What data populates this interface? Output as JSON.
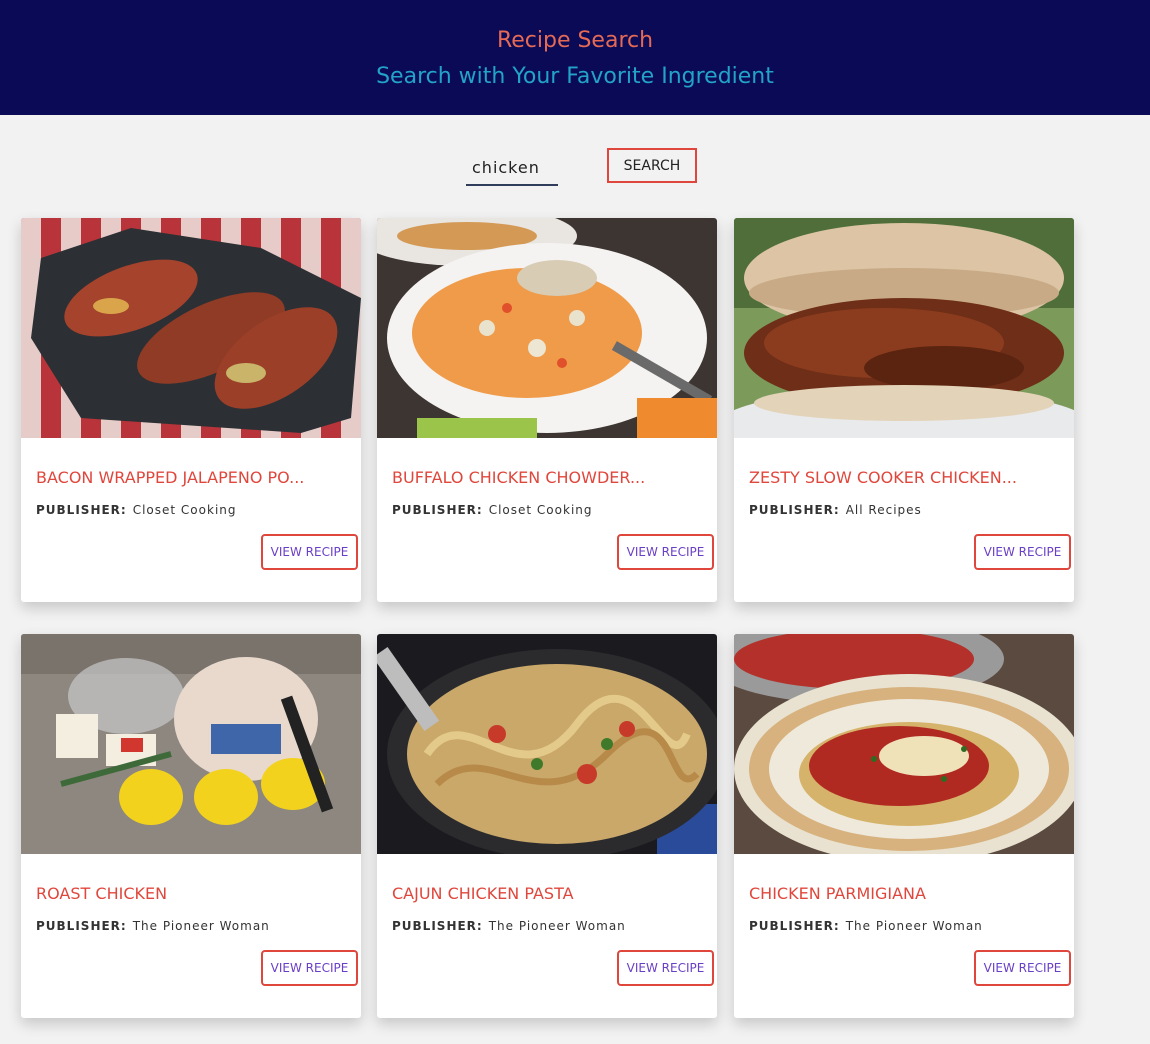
{
  "header": {
    "title": "Recipe Search",
    "subtitle": "Search with Your Favorite Ingredient"
  },
  "search": {
    "value": "chicken",
    "button_label": "SEARCH"
  },
  "publisher_label": "PUBLISHER:",
  "view_label": "VIEW RECIPE",
  "recipes": [
    {
      "title": "BACON WRAPPED JALAPENO PO...",
      "publisher": "Closet Cooking",
      "image": "bacon-wrapped-chicken-photo"
    },
    {
      "title": "BUFFALO CHICKEN CHOWDER...",
      "publisher": "Closet Cooking",
      "image": "chowder-bowl-photo"
    },
    {
      "title": "ZESTY SLOW COOKER CHICKEN...",
      "publisher": "All Recipes",
      "image": "pulled-chicken-sandwich-photo"
    },
    {
      "title": "ROAST CHICKEN",
      "publisher": "The Pioneer Woman",
      "image": "raw-chicken-lemons-photo"
    },
    {
      "title": "CAJUN CHICKEN PASTA",
      "publisher": "The Pioneer Woman",
      "image": "cajun-pasta-photo"
    },
    {
      "title": "CHICKEN PARMIGIANA",
      "publisher": "The Pioneer Woman",
      "image": "chicken-parmigiana-photo"
    }
  ],
  "colors": {
    "header_bg": "#0a0a57",
    "title": "#e56a55",
    "subtitle": "#23a3c8",
    "accent": "#e0473c",
    "view_text": "#6a3fc7"
  }
}
